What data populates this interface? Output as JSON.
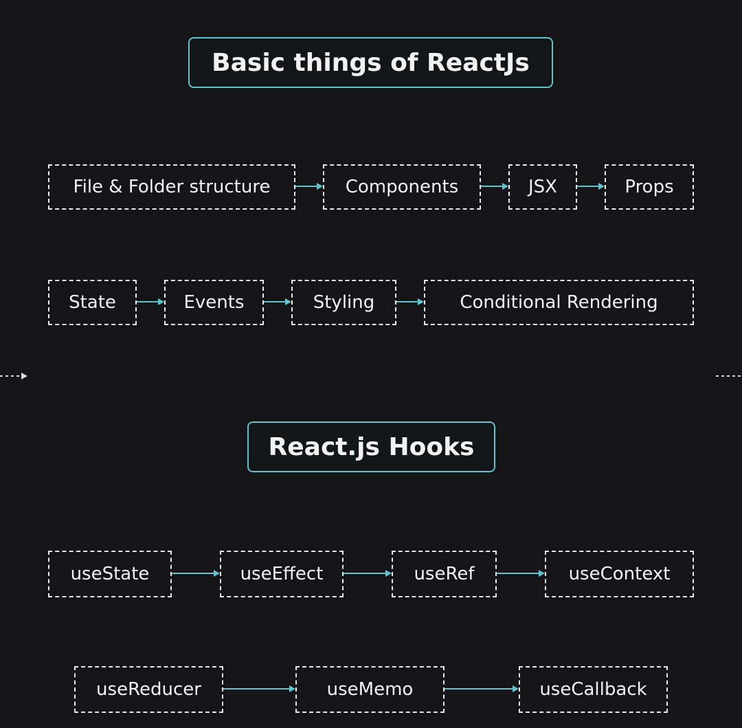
{
  "sections": [
    {
      "title": "Basic things of ReactJs",
      "rows": [
        [
          "File & Folder structure",
          "Components",
          "JSX",
          "Props"
        ],
        [
          "State",
          "Events",
          "Styling",
          "Conditional Rendering"
        ]
      ]
    },
    {
      "title": "React.js Hooks",
      "rows": [
        [
          "useState",
          "useEffect",
          "useRef",
          "useContext"
        ],
        [
          "useReducer",
          "useMemo",
          "useCallback"
        ]
      ]
    }
  ],
  "colors": {
    "background": "#151517",
    "accent": "#5ec4cf",
    "node_border": "#e8e8e8",
    "text": "#f2f2f2"
  }
}
